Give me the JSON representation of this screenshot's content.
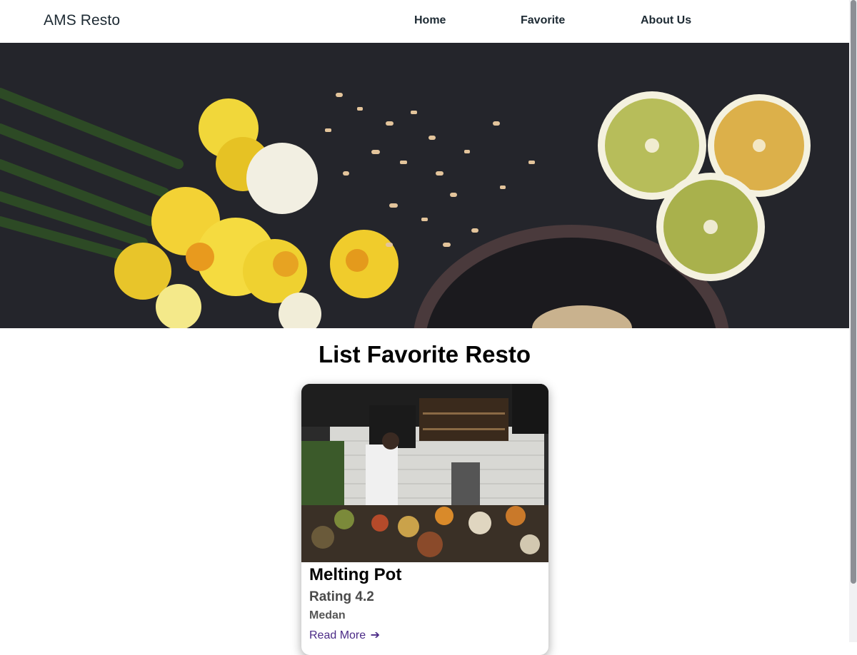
{
  "header": {
    "brand": "AMS Resto",
    "nav": {
      "home": "Home",
      "favorite": "Favorite",
      "about": "About Us"
    }
  },
  "main": {
    "title": "List Favorite Resto",
    "restaurants": [
      {
        "name": "Melting Pot",
        "rating": "Rating 4.2",
        "city": "Medan",
        "read_more": "Read More"
      }
    ]
  },
  "icons": {
    "read_more": "arrow-right-icon"
  },
  "colors": {
    "accent_link": "#4b2a86",
    "hero_bg": "#25262c"
  }
}
